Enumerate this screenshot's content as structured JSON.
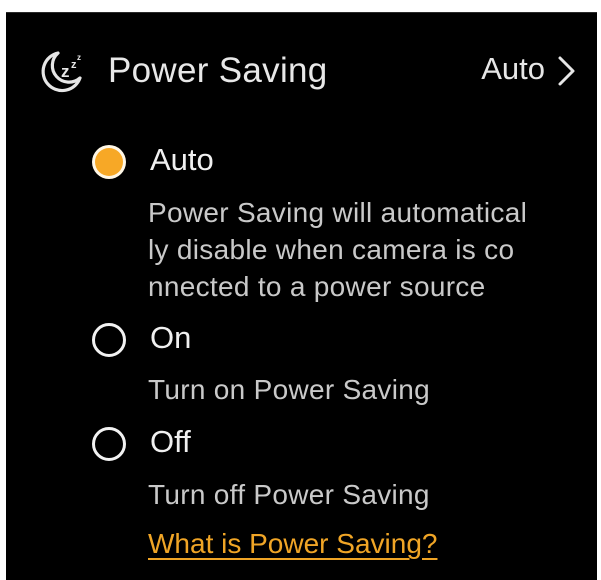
{
  "header": {
    "title": "Power Saving",
    "current_value": "Auto",
    "icon": "moon-sleep-icon",
    "chevron_icon": "chevron-right-icon"
  },
  "options": [
    {
      "label": "Auto",
      "selected": true,
      "description_lines": [
        "Power Saving will automatical",
        "ly disable when camera is co",
        "nnected to a power source"
      ]
    },
    {
      "label": "On",
      "selected": false,
      "description_lines": [
        "Turn on Power Saving"
      ]
    },
    {
      "label": "Off",
      "selected": false,
      "description_lines": [
        "Turn off Power Saving"
      ]
    }
  ],
  "help_link": "What is Power Saving?",
  "colors": {
    "background": "#000000",
    "accent": "#f7a826",
    "text": "#f0f0f0",
    "secondary_text": "#c9c9c9",
    "link": "#f0a526"
  }
}
